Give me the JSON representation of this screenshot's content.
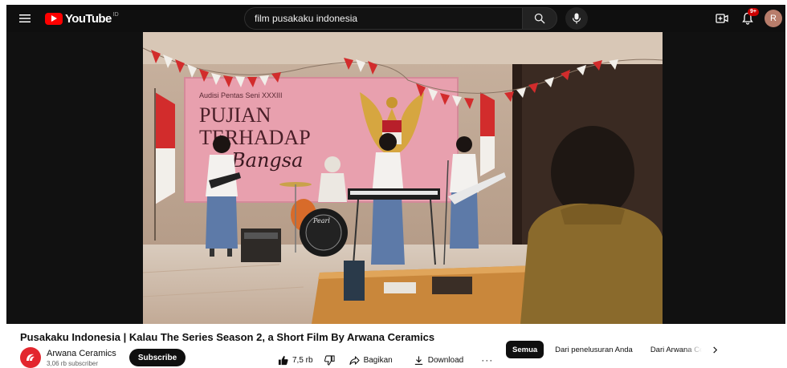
{
  "masthead": {
    "logo_text": "YouTube",
    "country_code": "ID",
    "search_query": "film pusakaku indonesia",
    "notification_count": "9+",
    "avatar_initial": "R"
  },
  "video": {
    "title": "Pusakaku Indonesia | Kalau The Series Season 2, a Short Film By Arwana Ceramics",
    "scene_texts": {
      "banner_small": "Audisi Pentas Seni XXXIII",
      "banner_line1": "PUJIAN",
      "banner_line2": "TERHADAP",
      "banner_line3": "Bangsa",
      "drum_brand": "Pearl"
    }
  },
  "channel": {
    "name": "Arwana Ceramics",
    "subscribers": "3,06 rb subscriber",
    "subscribe_label": "Subscribe"
  },
  "actions": {
    "likes": "7,5 rb",
    "share": "Bagikan",
    "download": "Download",
    "more": "···"
  },
  "chips": [
    {
      "label": "Semua",
      "active": true
    },
    {
      "label": "Dari penelusuran Anda",
      "active": false
    },
    {
      "label": "Dari Arwana Ceramics",
      "active": false
    }
  ],
  "colors": {
    "brand_red": "#ff0000",
    "masthead_bg": "#0f0f0f",
    "banner_pink": "#e8a0ae",
    "channel_red": "#e3262e"
  }
}
